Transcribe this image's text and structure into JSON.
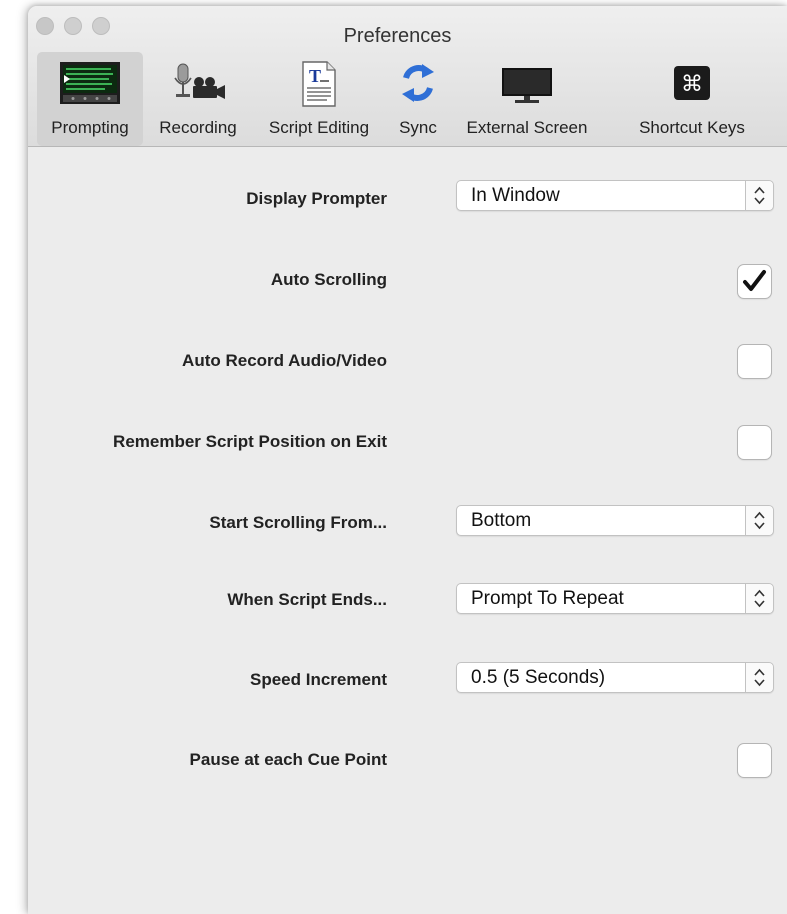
{
  "window": {
    "title": "Preferences"
  },
  "toolbar": {
    "items": [
      {
        "label": "Prompting",
        "icon": "prompter-screen-icon",
        "active": true
      },
      {
        "label": "Recording",
        "icon": "mic-camera-icon",
        "active": false
      },
      {
        "label": "Script Editing",
        "icon": "document-text-icon",
        "active": false
      },
      {
        "label": "Sync",
        "icon": "sync-arrows-icon",
        "active": false
      },
      {
        "label": "External Screen",
        "icon": "monitor-icon",
        "active": false
      },
      {
        "label": "Shortcut Keys",
        "icon": "command-key-icon",
        "active": false
      }
    ]
  },
  "settings": {
    "display_prompter": {
      "label": "Display Prompter",
      "value": "In Window"
    },
    "auto_scrolling": {
      "label": "Auto Scrolling",
      "checked": true
    },
    "auto_record": {
      "label": "Auto Record Audio/Video",
      "checked": false
    },
    "remember_position": {
      "label": "Remember Script Position on Exit",
      "checked": false
    },
    "start_scrolling": {
      "label": "Start Scrolling From...",
      "value": "Bottom"
    },
    "when_script_ends": {
      "label": "When Script Ends...",
      "value": "Prompt To Repeat"
    },
    "speed_increment": {
      "label": "Speed Increment",
      "value": "0.5 (5 Seconds)"
    },
    "pause_cue": {
      "label": "Pause at each Cue Point",
      "checked": false
    }
  },
  "colors": {
    "sync_icon": "#2f6fd6",
    "active_tab_bg": "#d2d2d2"
  }
}
